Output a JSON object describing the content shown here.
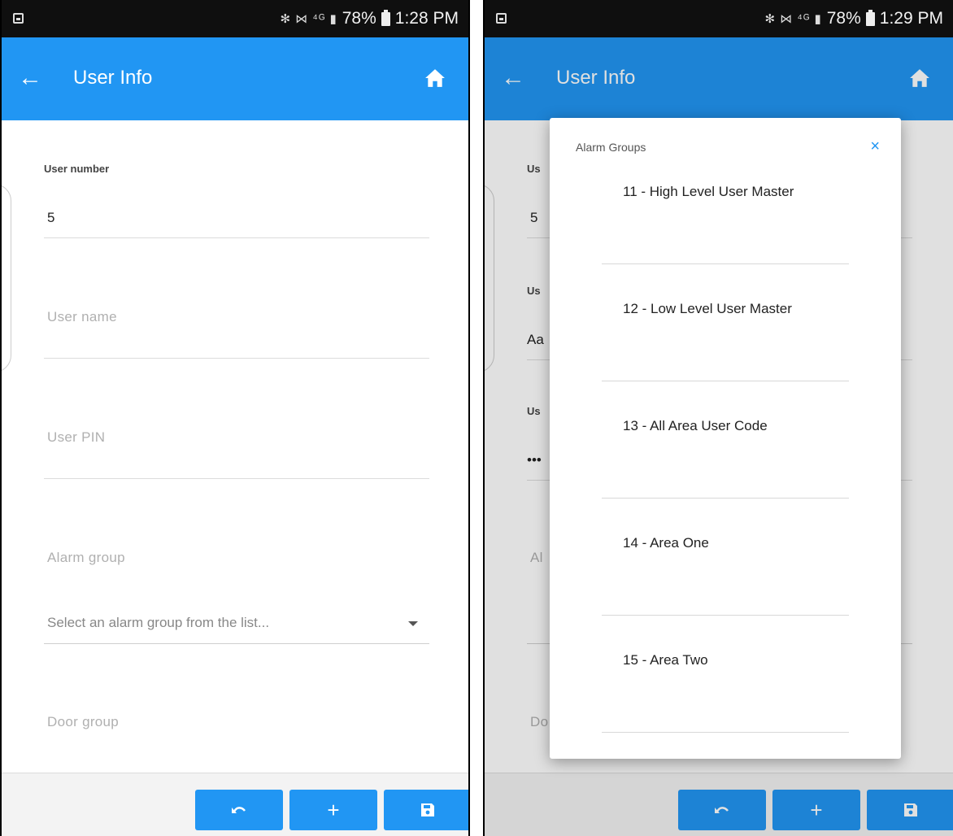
{
  "status_bar": {
    "icons": "✻ ⋈ ⁴ᴳ ▮",
    "battery_text": "78%",
    "time_left": "1:28 PM",
    "time_right": "1:29 PM"
  },
  "app_bar": {
    "title": "User Info",
    "back_icon": "←",
    "home_icon": "home-icon",
    "color": "#2196f3"
  },
  "form": {
    "user_number": {
      "label": "User number",
      "value": "5"
    },
    "user_name": {
      "placeholder": "User name"
    },
    "user_pin": {
      "placeholder": "User PIN"
    },
    "alarm_group": {
      "label": "Alarm group",
      "placeholder": "Select an alarm group from the list..."
    },
    "door_group": {
      "label": "Door group"
    }
  },
  "right_form_fragments": {
    "us1": "Us",
    "val1": "5",
    "us2": "Us",
    "val2": "Aa",
    "us3": "Us",
    "val3": "•••",
    "al": "Al",
    "do": "Do"
  },
  "bottom_bar": {
    "undo_icon": "undo-icon",
    "add_label": "+",
    "save_icon": "save-icon"
  },
  "modal": {
    "title": "Alarm Groups",
    "close_label": "×",
    "options": [
      "11 - High Level User Master",
      "12 - Low Level User Master",
      "13 - All Area User Code",
      "14 - Area One",
      "15 - Area Two"
    ]
  }
}
